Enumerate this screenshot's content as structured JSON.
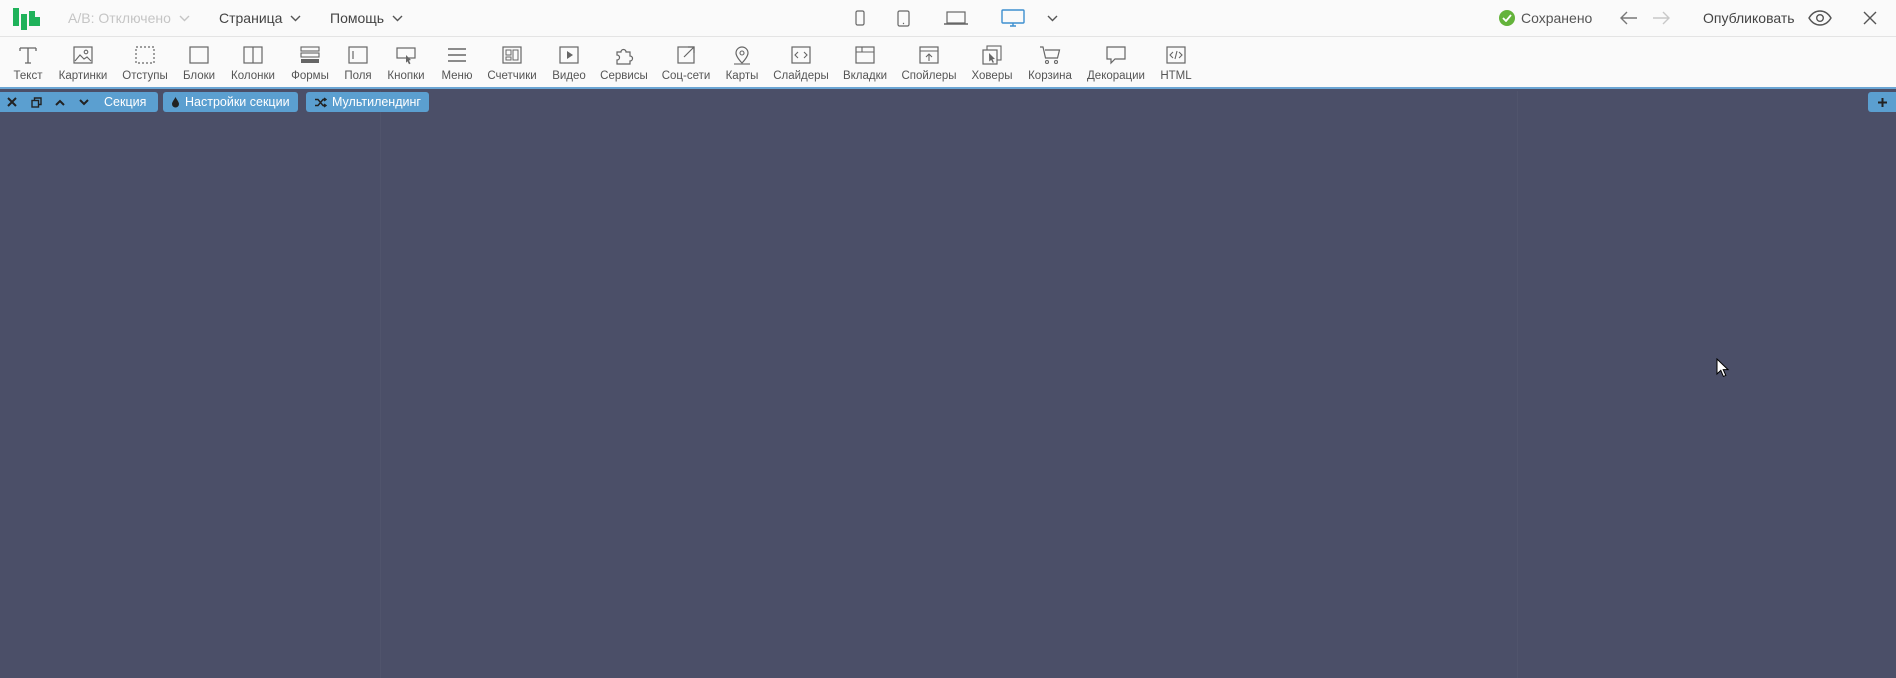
{
  "topbar": {
    "ab_test": "A/B: Отключено",
    "page_menu": "Страница",
    "help_menu": "Помощь",
    "status": "Сохранено",
    "publish": "Опубликовать"
  },
  "devices": [
    "mobile-portrait-icon",
    "tablet-icon",
    "laptop-icon",
    "desktop-icon"
  ],
  "tools": [
    "Текст",
    "Картинки",
    "Отступы",
    "Блоки",
    "Колонки",
    "Формы",
    "Поля",
    "Кнопки",
    "Меню",
    "Счетчики",
    "Видео",
    "Сервисы",
    "Соц-сети",
    "Карты",
    "Слайдеры",
    "Вкладки",
    "Спойлеры",
    "Ховеры",
    "Корзина",
    "Декорации",
    "HTML"
  ],
  "section": {
    "label": "Секция",
    "settings": "Настройки секции",
    "multilanding": "Мультилендинг"
  },
  "colors": {
    "accent": "#5b9fd0",
    "canvas": "#4b4f68",
    "saved_ok": "#64b33b",
    "logo": "#1fb25a"
  }
}
